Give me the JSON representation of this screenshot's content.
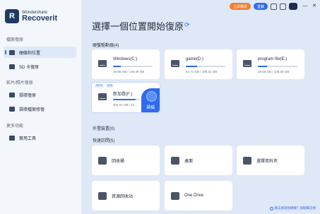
{
  "app": {
    "brand": "Wondershare",
    "product": "Recoverit"
  },
  "sidebar": {
    "sections": [
      {
        "title": "檔案復原"
      },
      {
        "title": "影片/照片復原"
      },
      {
        "title": "更多功能"
      }
    ],
    "items": [
      {
        "label": "硬碟和位置",
        "active": true
      },
      {
        "label": "SD 卡復原"
      },
      {
        "label": "損壞復原"
      },
      {
        "label": "損壞檔案修復"
      },
      {
        "label": "實用工具"
      }
    ]
  },
  "header": {
    "promo_button": "立即購買",
    "login_button": "登錄"
  },
  "main": {
    "title": "選擇一個位置開始復原",
    "hard_drives": {
      "label": "硬盤驅動器(4)",
      "drives": [
        {
          "name": "Windows(C:)",
          "size": "28.86 GB / 146.48 GB",
          "used_fraction": 0.2
        },
        {
          "name": "game(D:)",
          "size": "54.71 GB / 195.31 GB",
          "used_fraction": 0.28
        },
        {
          "name": "program file(E:)",
          "size": "29.58 GB / 128.00 GB",
          "used_fraction": 0.23
        },
        {
          "name": "新加卷(F:)",
          "size": "404.51 GB / 47...",
          "used_fraction": 0.85,
          "tags": [
            "NTFS",
            "SSD"
          ],
          "scan_label": "掃描"
        }
      ]
    },
    "external": {
      "label": "外置裝置(0)"
    },
    "quick_access": {
      "label": "快速訪問(5)",
      "items": [
        {
          "label": "回收桶",
          "icon": "recycle-bin-icon"
        },
        {
          "label": "桌面",
          "icon": "desktop-icon"
        },
        {
          "label": "選擇資料夾",
          "icon": "folder-icon"
        },
        {
          "label": "資源回收站",
          "icon": "trash-icon"
        },
        {
          "label": "One Drive",
          "icon": "cloud-icon"
        }
      ]
    },
    "help_link": "無法偵測到硬碟？請點擊這裡"
  }
}
